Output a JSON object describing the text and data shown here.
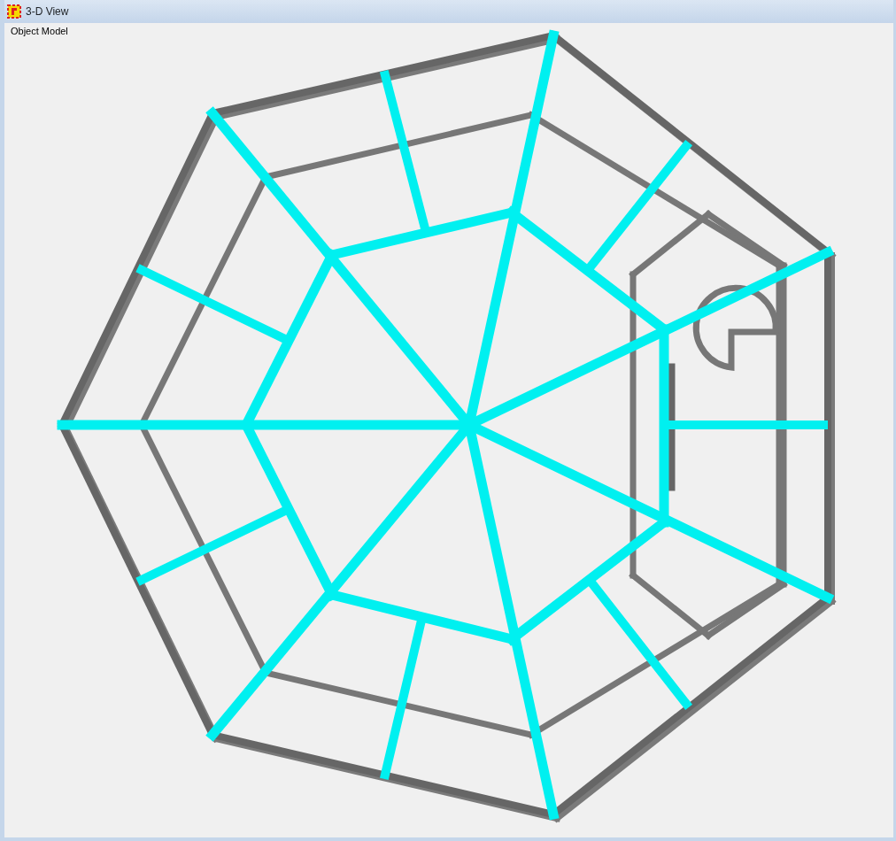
{
  "window": {
    "title": "3-D View"
  },
  "view": {
    "label": "Object Model"
  }
}
